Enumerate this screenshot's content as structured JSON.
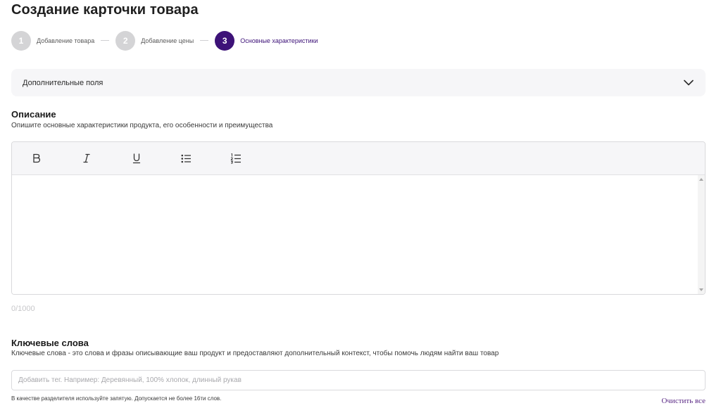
{
  "page": {
    "title": "Создание карточки товара"
  },
  "stepper": {
    "steps": [
      {
        "number": "1",
        "label": "Добавление товара"
      },
      {
        "number": "2",
        "label": "Добавление цены"
      },
      {
        "number": "3",
        "label": "Основные характеристики"
      }
    ],
    "active_step": 3
  },
  "accordion": {
    "label": "Дополнительные поля",
    "icon": "chevron-down-icon"
  },
  "description": {
    "title": "Описание",
    "subtitle": "Опишите основные характеристики продукта, его особенности и преимущества",
    "toolbar": [
      {
        "name": "bold-icon",
        "glyph": "B"
      },
      {
        "name": "italic-icon",
        "glyph": "I"
      },
      {
        "name": "underline-icon",
        "glyph": "U"
      },
      {
        "name": "bullet-list-icon"
      },
      {
        "name": "numbered-list-icon"
      }
    ],
    "value": "",
    "counter": "0/1000"
  },
  "keywords": {
    "title": "Ключевые слова",
    "subtitle": "Ключевые слова - это слова и фразы описывающие ваш продукт и предоставляют дополнительный контекст, чтобы помочь людям найти ваш товар",
    "placeholder": "Добавить тег. Например: Деревянный, 100% хлопок, длинный рукав",
    "value": "",
    "hint": "В качестве разделителя используйте запятую. Допускается не более 16ти слов.",
    "clear_label": "Очистить все"
  },
  "colors": {
    "accent": "#3d1278",
    "step_inactive": "#d4d4d6",
    "link": "#5b2a86"
  }
}
